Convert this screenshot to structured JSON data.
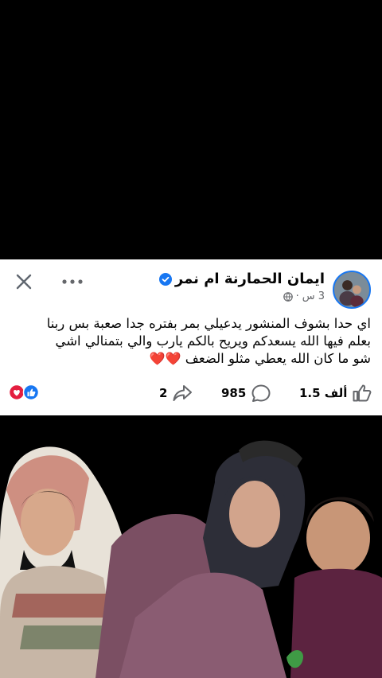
{
  "post": {
    "author": "ايمان الحمارنة  ام نمر",
    "time": "3 س",
    "dot": "·",
    "text_line1": "اي حدا بشوف المنشور يدعيلي بمر بفتره جدا صعبة بس ربنا",
    "text_line2": "بعلم فيها الله يسعدكم ويريح بالكم يارب والي بتمنالي اشي",
    "text_line3": "شو ما كان الله يعطي مثلو الضعف",
    "hearts": "❤️❤️"
  },
  "stats": {
    "likes": "1.5 ألف",
    "comments": "985",
    "shares": "2"
  },
  "icons": {
    "close": "close-icon",
    "more": "more-icon",
    "verified": "verified-icon",
    "globe": "globe-icon",
    "like": "like-icon",
    "comment": "comment-icon",
    "share": "share-icon"
  },
  "colors": {
    "verified": "#1877f2",
    "like_reaction": "#1877f2",
    "love_reaction": "#e41e3f"
  }
}
